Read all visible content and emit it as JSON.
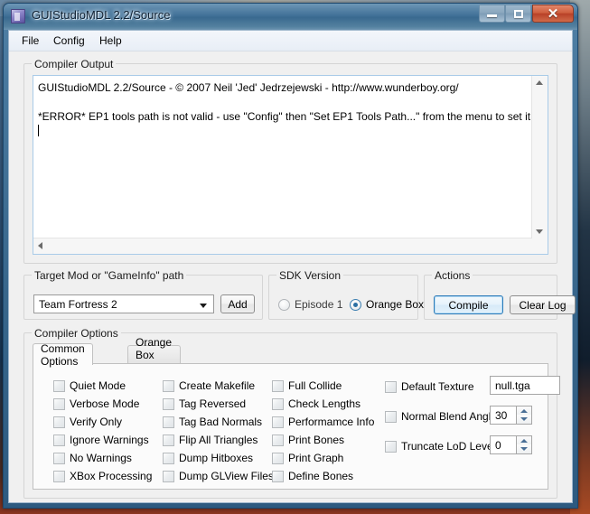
{
  "window": {
    "title": "GUIStudioMDL 2.2/Source",
    "icon": "app-icon",
    "controls": {
      "minimize": "minimize-icon",
      "maximize": "maximize-icon",
      "close": "✕"
    }
  },
  "menubar": {
    "items": [
      {
        "label": "File"
      },
      {
        "label": "Config"
      },
      {
        "label": "Help"
      }
    ]
  },
  "compiler_output": {
    "group_label": "Compiler Output",
    "lines": [
      "GUIStudioMDL 2.2/Source - © 2007 Neil 'Jed' Jedrzejewski - http://www.wunderboy.org/",
      "",
      "*ERROR* EP1 tools path is not valid - use \"Config\" then \"Set EP1 Tools Path...\" from the menu to set it."
    ],
    "scroll_up": "scroll-up-icon",
    "scroll_down": "scroll-down-icon",
    "scroll_left": "scroll-left-icon"
  },
  "target_mod": {
    "group_label": "Target Mod or \"GameInfo\" path",
    "selected": "Team Fortress 2",
    "dropdown_icon": "chevron-down-icon",
    "add_label": "Add"
  },
  "sdk_version": {
    "group_label": "SDK Version",
    "options": [
      {
        "label": "Episode 1",
        "selected": false
      },
      {
        "label": "Orange Box",
        "selected": true
      }
    ]
  },
  "actions": {
    "group_label": "Actions",
    "compile_label": "Compile",
    "clear_log_label": "Clear Log",
    "accent": "#2c7ab8"
  },
  "compiler_options": {
    "group_label": "Compiler Options",
    "tabs": [
      {
        "label": "Common Options",
        "active": true
      },
      {
        "label": "Orange Box Options",
        "active": false
      }
    ],
    "column1": [
      {
        "label": "Quiet Mode",
        "checked": false
      },
      {
        "label": "Verbose Mode",
        "checked": false
      },
      {
        "label": "Verify Only",
        "checked": false
      },
      {
        "label": "Ignore Warnings",
        "checked": false
      },
      {
        "label": "No Warnings",
        "checked": false
      },
      {
        "label": "XBox Processing",
        "checked": false
      }
    ],
    "column2": [
      {
        "label": "Create Makefile",
        "checked": false
      },
      {
        "label": "Tag Reversed",
        "checked": false
      },
      {
        "label": "Tag Bad Normals",
        "checked": false
      },
      {
        "label": "Flip All Triangles",
        "checked": false
      },
      {
        "label": "Dump Hitboxes",
        "checked": false
      },
      {
        "label": "Dump GLView Files",
        "checked": false
      }
    ],
    "column3": [
      {
        "label": "Full Collide",
        "checked": false
      },
      {
        "label": "Check Lengths",
        "checked": false
      },
      {
        "label": "Performamce Info",
        "checked": false
      },
      {
        "label": "Print Bones",
        "checked": false
      },
      {
        "label": "Print Graph",
        "checked": false
      },
      {
        "label": "Define Bones",
        "checked": false
      }
    ],
    "column4": [
      {
        "label": "Default Texture",
        "checked": false,
        "value": "null.tga",
        "kind": "text"
      },
      {
        "label": "Normal Blend Angle",
        "checked": false,
        "value": "30",
        "kind": "spin"
      },
      {
        "label": "Truncate LoD Level",
        "checked": false,
        "value": "0",
        "kind": "spin"
      }
    ]
  }
}
